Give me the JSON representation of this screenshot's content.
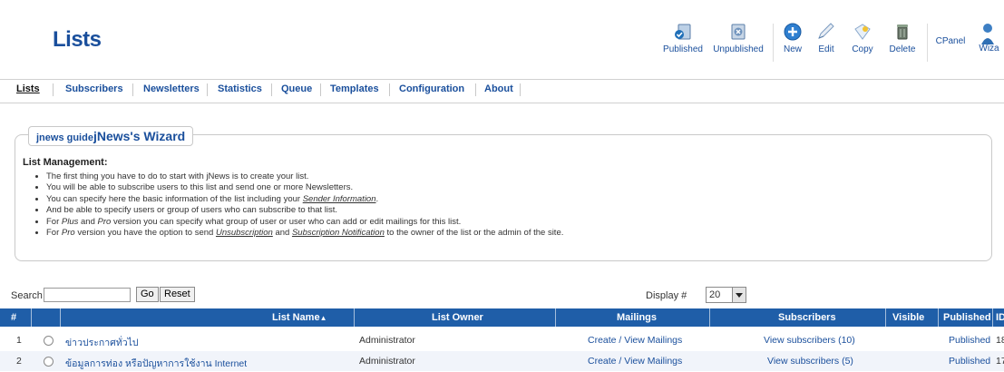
{
  "header": {
    "title": "Lists",
    "toolbar": [
      {
        "key": "published",
        "label": "Published",
        "icon": "publish-icon"
      },
      {
        "key": "unpublished",
        "label": "Unpublished",
        "icon": "unpublish-icon"
      },
      {
        "key": "new",
        "label": "New",
        "icon": "new-icon"
      },
      {
        "key": "edit",
        "label": "Edit",
        "icon": "edit-icon"
      },
      {
        "key": "copy",
        "label": "Copy",
        "icon": "copy-icon"
      },
      {
        "key": "delete",
        "label": "Delete",
        "icon": "delete-icon"
      },
      {
        "key": "cpanel",
        "label": "CPanel",
        "icon": ""
      },
      {
        "key": "wizard",
        "label": "Wiza",
        "icon": "wizard-icon"
      }
    ]
  },
  "nav": {
    "items": [
      "Lists",
      "Subscribers",
      "Newsletters",
      "Statistics",
      "Queue",
      "Templates",
      "Configuration",
      "About"
    ],
    "active": "Lists"
  },
  "wizard": {
    "legend_small": "jnews guide",
    "legend_big": "jNews's Wizard",
    "heading": "List Management:",
    "bullets": {
      "b1": "The first thing you have to do to start with jNews is to create your list.",
      "b2": "You will be able to subscribe users to this list and send one or more Newsletters.",
      "b3_pre": "You can specify here the basic information of the list including your ",
      "b3_link": "Sender Information",
      "b3_post": ".",
      "b4": "And be able to specify users or group of users who can subscribe to that list.",
      "b5_pre": "For ",
      "b5_plus": "Plus",
      "b5_and": " and ",
      "b5_pro": "Pro",
      "b5_post": " version you can specify what group of user or user who can add or edit mailings for this list.",
      "b6_pre": "For ",
      "b6_pro": "Pro",
      "b6_mid": " version you have the option to send ",
      "b6_link1": "Unsubscription",
      "b6_and": " and ",
      "b6_link2": "Subscription Notification",
      "b6_post": " to the owner of the list or the admin of the site."
    }
  },
  "search": {
    "label": "Search",
    "value": "",
    "go_label": "Go",
    "reset_label": "Reset",
    "display_label": "Display #",
    "display_value": "20"
  },
  "table": {
    "headers": {
      "num": "#",
      "name": "List Name",
      "owner": "List Owner",
      "mailings": "Mailings",
      "subscribers": "Subscribers",
      "visible": "Visible",
      "published": "Published",
      "id": "ID"
    },
    "rows": [
      {
        "num": "1",
        "name": "ข่าวประกาศทั่วไป",
        "owner": "Administrator",
        "mailings": "Create / View Mailings",
        "subscribers": "View subscribers (10)",
        "published": "Published",
        "id": "18"
      },
      {
        "num": "2",
        "name": "ข้อมูลการท่อง หรือปัญหาการใช้งาน Internet",
        "owner": "Administrator",
        "mailings": "Create / View Mailings",
        "subscribers": "View subscribers (5)",
        "published": "Published",
        "id": "17"
      }
    ]
  },
  "colors": {
    "accent": "#1a4f9c",
    "table_header": "#1f5ea8"
  }
}
